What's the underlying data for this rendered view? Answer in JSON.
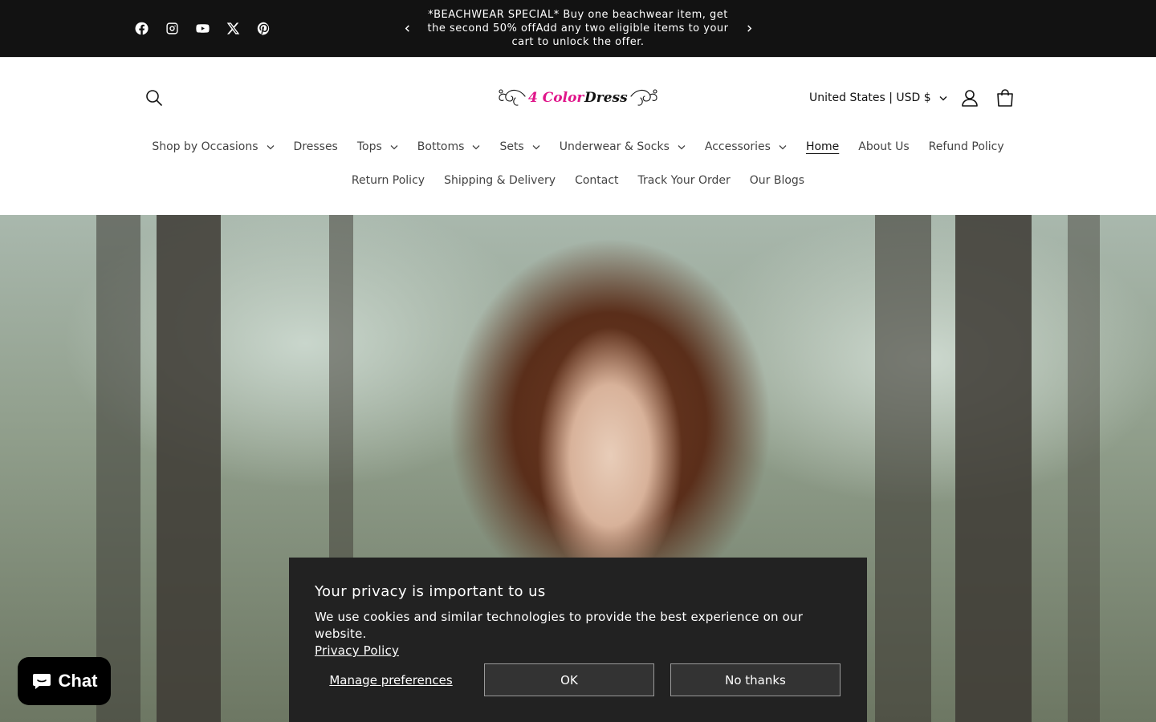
{
  "announcement": {
    "text": "*BEACHWEAR SPECIAL* Buy one beachwear item, get the second 50% offAdd any two eligible items to your cart to unlock the offer.",
    "socials": [
      "facebook-icon",
      "instagram-icon",
      "youtube-icon",
      "x-icon",
      "pinterest-icon"
    ]
  },
  "header": {
    "logo_text": "4 Color Dress",
    "country_selector": "United States | USD $"
  },
  "nav": {
    "row1": [
      {
        "label": "Shop by Occasions",
        "dropdown": true
      },
      {
        "label": "Dresses",
        "dropdown": false
      },
      {
        "label": "Tops",
        "dropdown": true
      },
      {
        "label": "Bottoms",
        "dropdown": true
      },
      {
        "label": "Sets",
        "dropdown": true
      },
      {
        "label": "Underwear & Socks",
        "dropdown": true
      },
      {
        "label": "Accessories",
        "dropdown": true
      },
      {
        "label": "Home",
        "dropdown": false,
        "active": true
      },
      {
        "label": "About Us",
        "dropdown": false
      },
      {
        "label": "Refund Policy",
        "dropdown": false
      }
    ],
    "row2": [
      {
        "label": "Return Policy"
      },
      {
        "label": "Shipping & Delivery"
      },
      {
        "label": "Contact"
      },
      {
        "label": "Track Your Order"
      },
      {
        "label": "Our Blogs"
      }
    ]
  },
  "chat": {
    "label": "Chat"
  },
  "privacy": {
    "title": "Your privacy is important to us",
    "text": "We use cookies and similar technologies to provide the best experience on our website.",
    "link": "Privacy Policy",
    "manage": "Manage preferences",
    "ok": "OK",
    "no_thanks": "No thanks"
  },
  "colors": {
    "announcement_bg": "#121212",
    "modal_bg": "#222222",
    "logo_pink": "#e0158a"
  }
}
